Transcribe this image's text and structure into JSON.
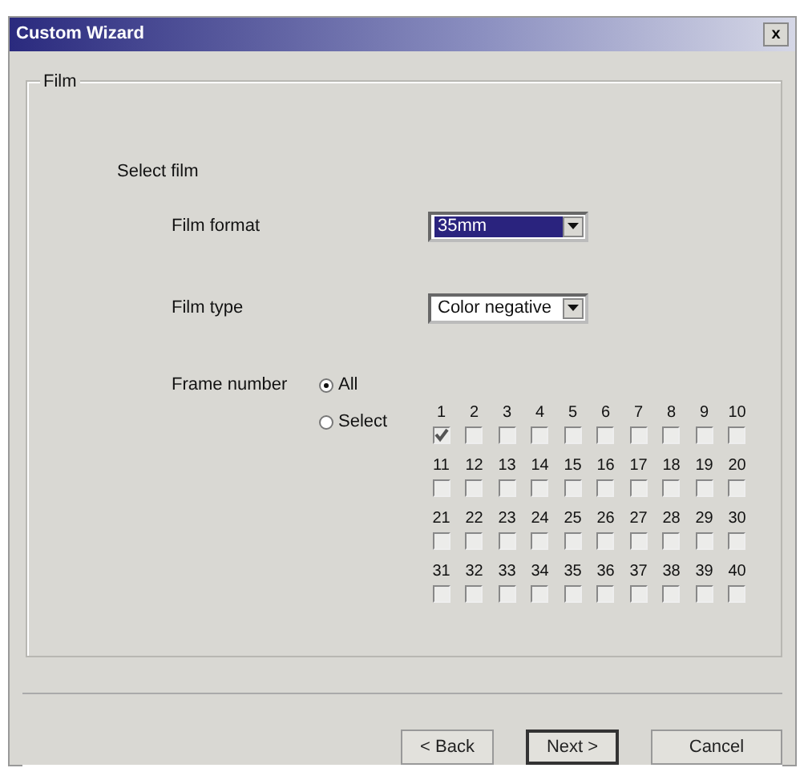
{
  "window": {
    "title": "Custom Wizard",
    "close": "x"
  },
  "group": {
    "title": "Film"
  },
  "heading": "Select film",
  "fields": [
    {
      "label": "Film format",
      "value": "35mm",
      "focused": true
    },
    {
      "label": "Film type",
      "value": "Color negative",
      "focused": false
    }
  ],
  "frame_number": {
    "label": "Frame number",
    "options": [
      {
        "label": "All",
        "selected": true
      },
      {
        "label": "Select",
        "selected": false
      }
    ],
    "frames_disabled": true,
    "frames": [
      {
        "number": "1",
        "checked": true
      },
      {
        "number": "2",
        "checked": false
      },
      {
        "number": "3",
        "checked": false
      },
      {
        "number": "4",
        "checked": false
      },
      {
        "number": "5",
        "checked": false
      },
      {
        "number": "6",
        "checked": false
      },
      {
        "number": "7",
        "checked": false
      },
      {
        "number": "8",
        "checked": false
      },
      {
        "number": "9",
        "checked": false
      },
      {
        "number": "10",
        "checked": false
      },
      {
        "number": "11",
        "checked": false
      },
      {
        "number": "12",
        "checked": false
      },
      {
        "number": "13",
        "checked": false
      },
      {
        "number": "14",
        "checked": false
      },
      {
        "number": "15",
        "checked": false
      },
      {
        "number": "16",
        "checked": false
      },
      {
        "number": "17",
        "checked": false
      },
      {
        "number": "18",
        "checked": false
      },
      {
        "number": "19",
        "checked": false
      },
      {
        "number": "20",
        "checked": false
      },
      {
        "number": "21",
        "checked": false
      },
      {
        "number": "22",
        "checked": false
      },
      {
        "number": "23",
        "checked": false
      },
      {
        "number": "24",
        "checked": false
      },
      {
        "number": "25",
        "checked": false
      },
      {
        "number": "26",
        "checked": false
      },
      {
        "number": "27",
        "checked": false
      },
      {
        "number": "28",
        "checked": false
      },
      {
        "number": "29",
        "checked": false
      },
      {
        "number": "30",
        "checked": false
      },
      {
        "number": "31",
        "checked": false
      },
      {
        "number": "32",
        "checked": false
      },
      {
        "number": "33",
        "checked": false
      },
      {
        "number": "34",
        "checked": false
      },
      {
        "number": "35",
        "checked": false
      },
      {
        "number": "36",
        "checked": false
      },
      {
        "number": "37",
        "checked": false
      },
      {
        "number": "38",
        "checked": false
      },
      {
        "number": "39",
        "checked": false
      },
      {
        "number": "40",
        "checked": false
      }
    ]
  },
  "buttons": [
    {
      "label": "< Back",
      "default": false
    },
    {
      "label": "Next >",
      "default": true
    },
    {
      "label": "Cancel",
      "default": false
    }
  ]
}
